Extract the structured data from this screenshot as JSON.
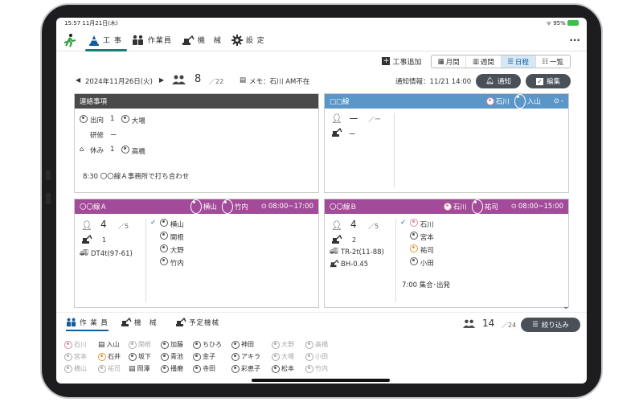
{
  "status": {
    "time": "15:57  11月21日(木)",
    "battery": "95%"
  },
  "nav": {
    "tabs": [
      {
        "label": "工 事",
        "icon": "cone-icon"
      },
      {
        "label": "作業員",
        "icon": "workers-icon"
      },
      {
        "label": "機　械",
        "icon": "excavator-icon"
      },
      {
        "label": "設 定",
        "icon": "gear-icon"
      }
    ],
    "more": "···"
  },
  "toolbar": {
    "add": "工事追加",
    "views": [
      "月間",
      "週間",
      "日程",
      "一覧"
    ],
    "active_view": "日程"
  },
  "info": {
    "date": "2024年11月26日(火)",
    "count": "8",
    "total": "／22",
    "memo": "メモ：石川 AM不在",
    "notice": "通知情報：11/21 14:00",
    "notify_btn": "通知",
    "edit_btn": "編集"
  },
  "cards": {
    "contact": {
      "title": "連絡事項",
      "l1a": "出向",
      "l1b": "1",
      "l1c": "大場",
      "l2a": "研修",
      "l2b": "ー",
      "l3a": "休み",
      "l3b": "1",
      "l3c": "高橋",
      "note": "8:30 〇〇線Ａ事務所で打ち合わせ",
      "color": "#4a4a4a"
    },
    "ss": {
      "title": "□□線",
      "p1": "石川",
      "p2": "入山",
      "time": "-",
      "count": "ー",
      "total": "／ー",
      "mcount": "ー",
      "color": "#5b96c9"
    },
    "a": {
      "title": "〇〇線Ａ",
      "p1": "横山",
      "p2": "竹内",
      "time": "08:00~17:00",
      "count": "4",
      "total": "／5",
      "mcount": "1",
      "truck": "DT4t(97-61)",
      "workers": [
        "横山",
        "関根",
        "大野",
        "竹内"
      ],
      "color": "#a24b98"
    },
    "b": {
      "title": "〇〇線Ｂ",
      "p1": "石川",
      "p2": "祐司",
      "time": "08:00~15:00",
      "count": "4",
      "total": "／5",
      "mcount": "2",
      "truck": "TR-2t(11-88)",
      "machine": "BH-0.45",
      "workers": [
        "石川",
        "宮本",
        "祐司",
        "小田"
      ],
      "note": "7:00 集合･出発",
      "color": "#a24b98"
    }
  },
  "bottom": {
    "tabs": [
      "作 業 員",
      "機　械",
      "予定機械"
    ],
    "count": "14",
    "total": "／24",
    "filter": "絞り込み",
    "row1": [
      {
        "n": "石川",
        "c": "grey-pink"
      },
      {
        "n": "入山",
        "c": "doc"
      },
      {
        "n": "関根",
        "c": "grey"
      },
      {
        "n": "加藤",
        "c": "dark"
      },
      {
        "n": "ちひろ",
        "c": "dark"
      },
      {
        "n": "神田",
        "c": "dark"
      },
      {
        "n": "大野",
        "c": "grey"
      },
      {
        "n": "高橋",
        "c": "grey"
      }
    ],
    "row2": [
      {
        "n": "宮本",
        "c": "grey"
      },
      {
        "n": "石井",
        "c": "orange"
      },
      {
        "n": "坂下",
        "c": "dark"
      },
      {
        "n": "青池",
        "c": "dark"
      },
      {
        "n": "金子",
        "c": "dark"
      },
      {
        "n": "アキラ",
        "c": "dark"
      },
      {
        "n": "大場",
        "c": "grey"
      },
      {
        "n": "小田",
        "c": "grey"
      }
    ],
    "row3": [
      {
        "n": "横山",
        "c": "grey"
      },
      {
        "n": "祐司",
        "c": "grey"
      },
      {
        "n": "岡澤",
        "c": "doc"
      },
      {
        "n": "播磨",
        "c": "dark"
      },
      {
        "n": "寺田",
        "c": "dark"
      },
      {
        "n": "彩恵子",
        "c": "dark"
      },
      {
        "n": "松本",
        "c": "dark"
      },
      {
        "n": "竹内",
        "c": "grey"
      }
    ]
  }
}
